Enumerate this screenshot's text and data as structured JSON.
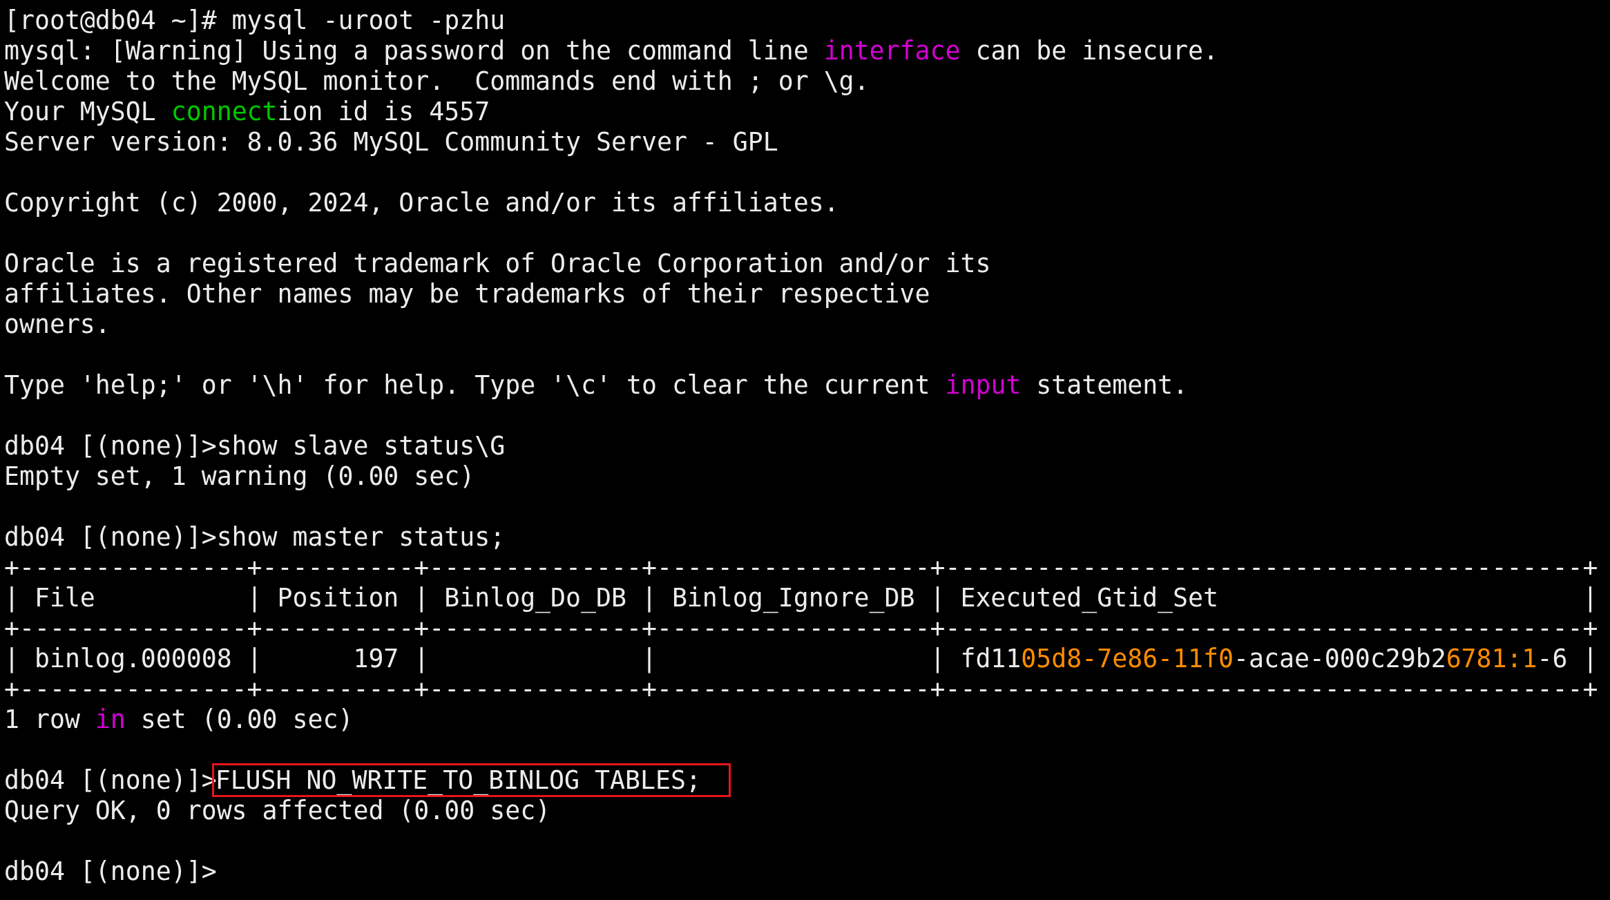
{
  "terminal": {
    "lines": [
      {
        "kind": "text",
        "segments": [
          {
            "text": "[root@db04 ~]# mysql -uroot -pzhu"
          }
        ]
      },
      {
        "kind": "text",
        "segments": [
          {
            "text": "mysql: [Warning] Using a password on the command line "
          },
          {
            "text": "interface",
            "color": "#d400d4"
          },
          {
            "text": " can be insecure."
          }
        ]
      },
      {
        "kind": "text",
        "segments": [
          {
            "text": "Welcome to the MySQL monitor.  Commands end with ; or \\g."
          }
        ]
      },
      {
        "kind": "text",
        "segments": [
          {
            "text": "Your MySQL "
          },
          {
            "text": "connect",
            "color": "#00c800"
          },
          {
            "text": "ion id is 4557"
          }
        ]
      },
      {
        "kind": "text",
        "segments": [
          {
            "text": "Server version: 8.0.36 MySQL Community Server - GPL"
          }
        ]
      },
      {
        "kind": "blank"
      },
      {
        "kind": "text",
        "segments": [
          {
            "text": "Copyright (c) 2000, 2024, Oracle and/or its affiliates."
          }
        ]
      },
      {
        "kind": "blank"
      },
      {
        "kind": "text",
        "segments": [
          {
            "text": "Oracle is a registered trademark of Oracle Corporation and/or its"
          }
        ]
      },
      {
        "kind": "text",
        "segments": [
          {
            "text": "affiliates. Other names may be trademarks of their respective"
          }
        ]
      },
      {
        "kind": "text",
        "segments": [
          {
            "text": "owners."
          }
        ]
      },
      {
        "kind": "blank"
      },
      {
        "kind": "text",
        "segments": [
          {
            "text": "Type 'help;' or '\\h' for help. Type '\\c' to clear the current "
          },
          {
            "text": "input",
            "color": "#d400d4"
          },
          {
            "text": " statement."
          }
        ]
      },
      {
        "kind": "blank"
      },
      {
        "kind": "text",
        "segments": [
          {
            "text": "db04 [(none)]>show slave status\\G"
          }
        ]
      },
      {
        "kind": "text",
        "segments": [
          {
            "text": "Empty set, 1 warning (0.00 sec)"
          }
        ]
      },
      {
        "kind": "blank"
      },
      {
        "kind": "text",
        "segments": [
          {
            "text": "db04 [(none)]>show master status;"
          }
        ]
      },
      {
        "kind": "text",
        "segments": [
          {
            "text": "+---------------+----------+--------------+------------------+------------------------------------------+"
          }
        ]
      },
      {
        "kind": "text",
        "segments": [
          {
            "text": "| File          | Position | Binlog_Do_DB | Binlog_Ignore_DB | Executed_Gtid_Set                        |"
          }
        ]
      },
      {
        "kind": "text",
        "segments": [
          {
            "text": "+---------------+----------+--------------+------------------+------------------------------------------+"
          }
        ]
      },
      {
        "kind": "text",
        "segments": [
          {
            "text": "| binlog.000008 |      197 |              |                  | fd11"
          },
          {
            "text": "05d8-7e86-11f0",
            "color": "#ff8c00"
          },
          {
            "text": "-acae-000c29b2"
          },
          {
            "text": "6781:1",
            "color": "#ff8c00"
          },
          {
            "text": "-6 |"
          }
        ]
      },
      {
        "kind": "text",
        "segments": [
          {
            "text": "+---------------+----------+--------------+------------------+------------------------------------------+"
          }
        ]
      },
      {
        "kind": "text",
        "segments": [
          {
            "text": "1 row "
          },
          {
            "text": "in",
            "color": "#d400d4"
          },
          {
            "text": " set (0.00 sec)"
          }
        ]
      },
      {
        "kind": "blank"
      },
      {
        "kind": "text",
        "segments": [
          {
            "text": "db04 [(none)]>"
          },
          {
            "text": "FLUSH NO_WRITE_TO_BINLOG TABLES;",
            "highlighted": true
          }
        ]
      },
      {
        "kind": "text",
        "segments": [
          {
            "text": "Query OK, 0 rows affected (0.00 sec)"
          }
        ]
      },
      {
        "kind": "blank"
      },
      {
        "kind": "text",
        "segments": [
          {
            "text": "db04 [(none)]>"
          }
        ]
      }
    ]
  }
}
